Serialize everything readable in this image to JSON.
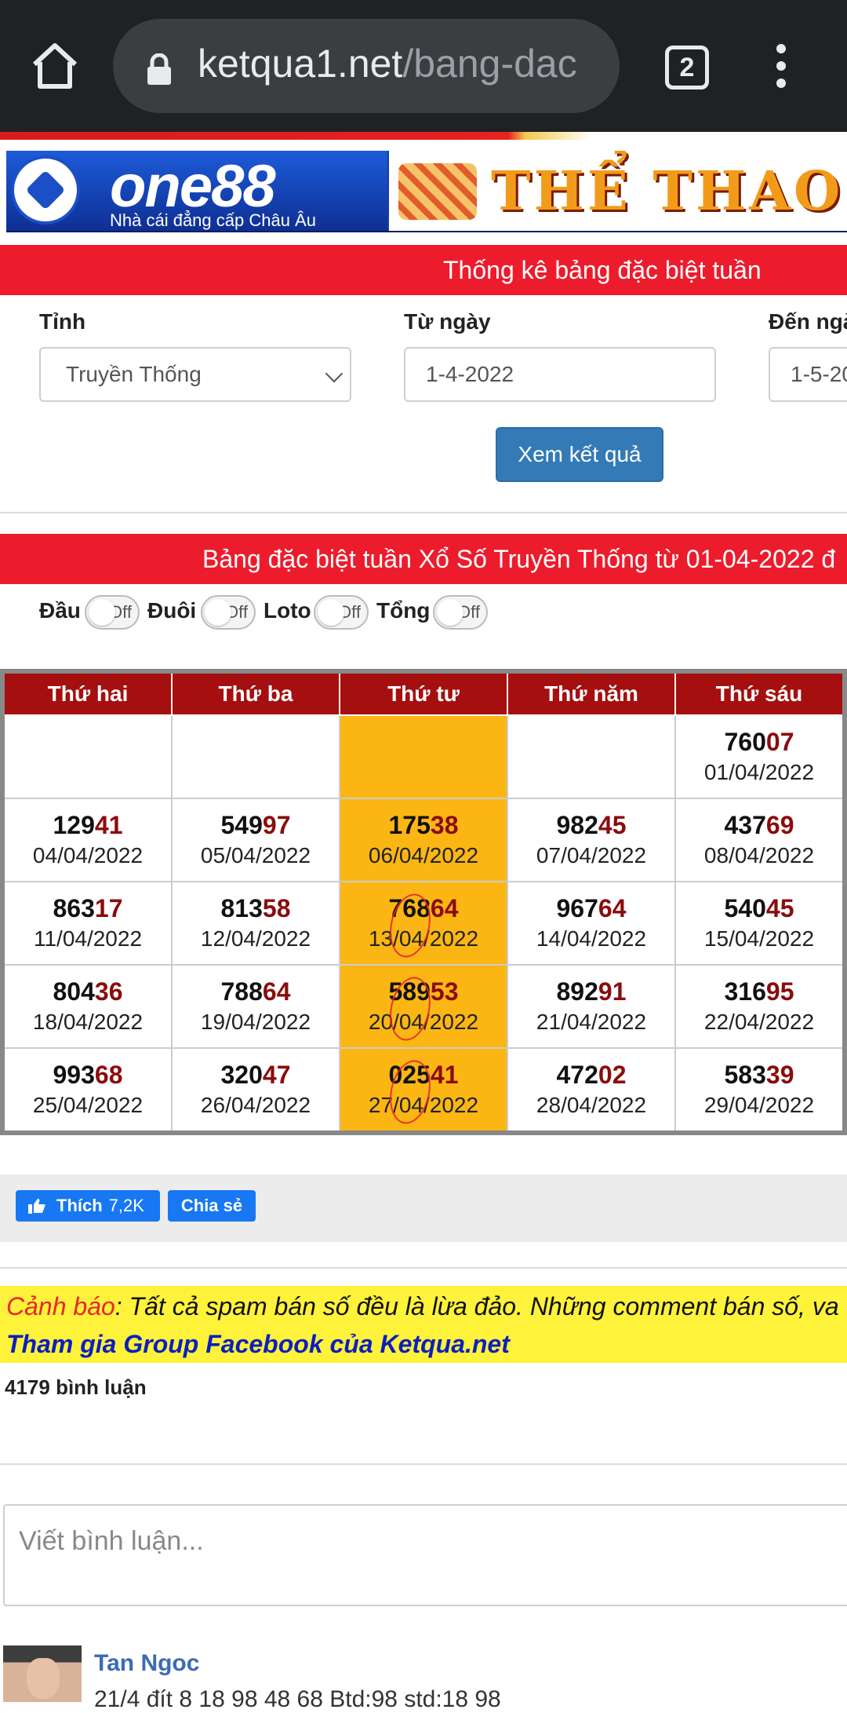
{
  "browser": {
    "url_host": "ketqua1.net",
    "url_path": "/bang-dac",
    "tab_count": "2"
  },
  "ad": {
    "brand": "one88",
    "tagline": "Nhà cái đẳng cấp Châu Âu",
    "title": "THỂ THAO"
  },
  "header": {
    "title": "Thống kê bảng đặc biệt tuần"
  },
  "filters": {
    "province_label": "Tỉnh",
    "province_value": "Truyền Thống",
    "from_label": "Từ ngày",
    "from_value": "1-4-2022",
    "to_label": "Đến ngà",
    "to_value": "1-5-20",
    "submit_label": "Xem kết quả"
  },
  "results": {
    "title": "Bảng đặc biệt tuần Xổ Số Truyền Thống từ 01-04-2022 đ",
    "toggles": [
      {
        "label": "Đầu",
        "state": "Off"
      },
      {
        "label": "Đuôi",
        "state": "Off"
      },
      {
        "label": "Loto",
        "state": "Off"
      },
      {
        "label": "Tổng",
        "state": "Off"
      }
    ],
    "columns": [
      "Thứ hai",
      "Thứ ba",
      "Thứ tư",
      "Thứ năm",
      "Thứ sáu"
    ],
    "rows": [
      [
        null,
        null,
        null,
        null,
        {
          "head": "760",
          "tail": "07",
          "date": "01/04/2022"
        }
      ],
      [
        {
          "head": "129",
          "tail": "41",
          "date": "04/04/2022"
        },
        {
          "head": "549",
          "tail": "97",
          "date": "05/04/2022"
        },
        {
          "head": "175",
          "tail": "38",
          "date": "06/04/2022"
        },
        {
          "head": "982",
          "tail": "45",
          "date": "07/04/2022"
        },
        {
          "head": "437",
          "tail": "69",
          "date": "08/04/2022"
        }
      ],
      [
        {
          "head": "863",
          "tail": "17",
          "date": "11/04/2022"
        },
        {
          "head": "813",
          "tail": "58",
          "date": "12/04/2022"
        },
        {
          "head": "768",
          "tail": "64",
          "date": "13/04/2022"
        },
        {
          "head": "967",
          "tail": "64",
          "date": "14/04/2022"
        },
        {
          "head": "540",
          "tail": "45",
          "date": "15/04/2022"
        }
      ],
      [
        {
          "head": "804",
          "tail": "36",
          "date": "18/04/2022"
        },
        {
          "head": "788",
          "tail": "64",
          "date": "19/04/2022"
        },
        {
          "head": "589",
          "tail": "53",
          "date": "20/04/2022"
        },
        {
          "head": "892",
          "tail": "91",
          "date": "21/04/2022"
        },
        {
          "head": "316",
          "tail": "95",
          "date": "22/04/2022"
        }
      ],
      [
        {
          "head": "993",
          "tail": "68",
          "date": "25/04/2022"
        },
        {
          "head": "320",
          "tail": "47",
          "date": "26/04/2022"
        },
        {
          "head": "025",
          "tail": "41",
          "date": "27/04/2022"
        },
        {
          "head": "472",
          "tail": "02",
          "date": "28/04/2022"
        },
        {
          "head": "583",
          "tail": "39",
          "date": "29/04/2022"
        }
      ]
    ],
    "highlight_column": 2,
    "highlight_color": "#fbb614",
    "circled_cells": [
      [
        2,
        2
      ],
      [
        3,
        2
      ],
      [
        4,
        2
      ]
    ]
  },
  "social": {
    "like_label": "Thích",
    "like_count": "7,2K",
    "share_label": "Chia sẻ"
  },
  "warning": {
    "label": "Cảnh báo",
    "text": ": Tất cả spam bán số đều là lừa đảo. Những comment bán số, va",
    "group_link": "Tham gia Group Facebook của Ketqua.net"
  },
  "comments": {
    "count_text": "4179 bình luận",
    "input_placeholder": "Viết bình luận...",
    "first": {
      "author": "Tan Ngoc",
      "text": "21/4 đít 8 18 98 48 68  Btd:98 std:18 98"
    }
  },
  "colors": {
    "accent_red": "#ec1c2d",
    "header_dark_red": "#a50f0f",
    "button_blue": "#337ab7",
    "warning_yellow": "#fff23a"
  }
}
